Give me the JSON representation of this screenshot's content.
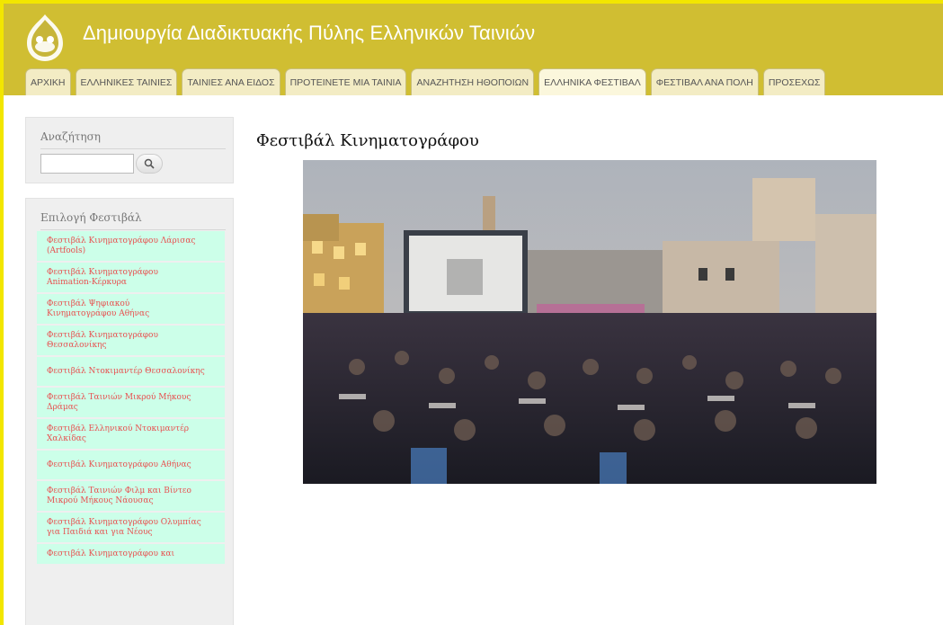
{
  "site": {
    "name": "Δημιουργία Διαδικτυακής Πύλης Ελληνικών Ταινιών"
  },
  "nav": {
    "tabs": [
      {
        "label": "ΑΡΧΙΚΗ"
      },
      {
        "label": "ΕΛΛΗΝΙΚΕΣ ΤΑΙΝΙΕΣ"
      },
      {
        "label": "ΤΑΙΝΙΕΣ ΑΝΑ ΕΙΔΟΣ"
      },
      {
        "label": "ΠΡΟΤΕΙΝΕΤΕ ΜΙΑ ΤΑΙΝΙΑ"
      },
      {
        "label": "ΑΝΑΖΗΤΗΣΗ ΗΘΟΠΟΙΩΝ"
      },
      {
        "label": "ΕΛΛΗΝΙΚΑ ΦΕΣΤΙΒΑΛ"
      },
      {
        "label": "ΦΕΣΤΙΒΑΛ ΑΝΑ ΠΟΛΗ"
      },
      {
        "label": "ΠΡΟΣΕΧΩΣ"
      }
    ]
  },
  "sidebar": {
    "search": {
      "title": "Αναζήτηση",
      "value": "",
      "placeholder": ""
    },
    "festivals": {
      "title": "Επιλογή Φεστιβάλ",
      "items": [
        {
          "line1": "Φεστιβάλ Κινηματογράφου Λάρισας",
          "line2": "(Artfools)"
        },
        {
          "line1": "Φεστιβάλ Κινηματογράφου",
          "line2": "Animation-Κέρκυρα"
        },
        {
          "line1": "Φεστιβάλ Ψηφιακού",
          "line2": "Κινηματογράφου Αθήνας"
        },
        {
          "line1": "Φεστιβάλ Κινηματογράφου",
          "line2": "Θεσσαλονίκης"
        },
        {
          "line1": "Φεστιβάλ Ντοκιμαντέρ Θεσσαλονίκης",
          "line2": ""
        },
        {
          "line1": "Φεστιβάλ Ταινιών Μικρού Μήκους",
          "line2": "Δράμας"
        },
        {
          "line1": "Φεστιβάλ Ελληνικού Ντοκιμαντέρ",
          "line2": "Χαλκίδας"
        },
        {
          "line1": "Φεστιβάλ Κινηματογράφου Αθήνας",
          "line2": ""
        },
        {
          "line1": "Φεστιβάλ Ταινιών Φιλμ και Βίντεο",
          "line2": "Μικρού Μήκους Νάουσας"
        },
        {
          "line1": "Φεστιβάλ Κινηματογράφου Ολυμπίας",
          "line2": "για Παιδιά και για Νέους"
        },
        {
          "line1": "Φεστιβάλ Κινηματογράφου και",
          "line2": ""
        }
      ]
    }
  },
  "main": {
    "title": "Φεστιβάλ Κινηματογράφου"
  },
  "colors": {
    "header": "#d0be32",
    "frame": "#f2e600",
    "list_bg": "#ccffe9",
    "link": "#e85050"
  }
}
